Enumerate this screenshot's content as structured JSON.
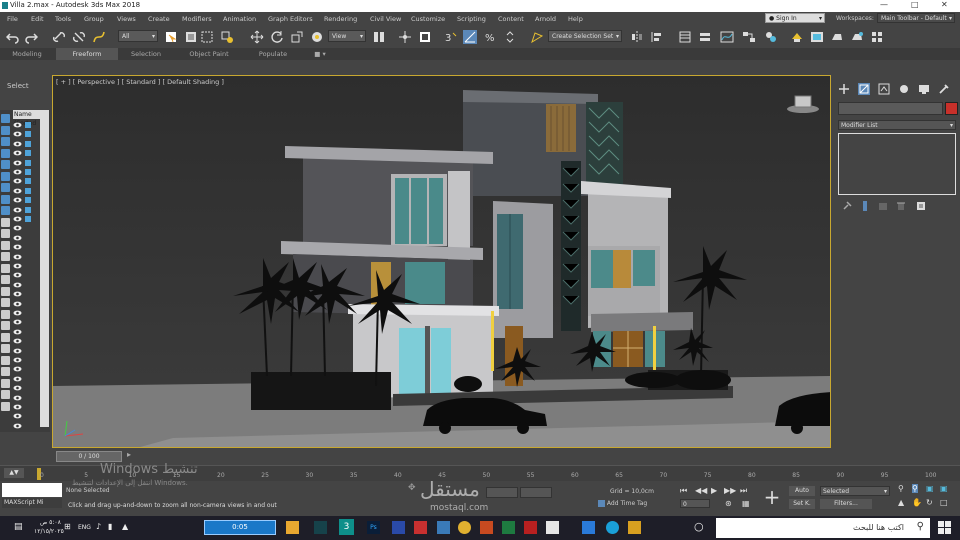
{
  "window": {
    "title": "Villa 2.max - Autodesk 3ds Max 2018"
  },
  "menu": [
    "File",
    "Edit",
    "Tools",
    "Group",
    "Views",
    "Create",
    "Modifiers",
    "Animation",
    "Graph Editors",
    "Rendering",
    "Civil View",
    "Customize",
    "Scripting",
    "Content",
    "Arnold",
    "Help"
  ],
  "account": {
    "sign_in": "Sign In",
    "workspaces_label": "Workspaces:",
    "workspace_value": "Main Toolbar - Default"
  },
  "toolbar": {
    "filter_value": "All",
    "refcoord_value": "View",
    "selection_set": "Create Selection Set"
  },
  "ribbon_tabs": [
    "Modeling",
    "Freeform",
    "Selection",
    "Object Paint",
    "Populate"
  ],
  "ribbon_active": 1,
  "left": {
    "select_label": "Select",
    "column_header": "Name (Sorted"
  },
  "viewport": {
    "label": "[ + ] [ Perspective ] [ Standard ] [ Default Shading ]"
  },
  "command_panel": {
    "modifier_list": "Modifier List",
    "color_swatch": "#c8302a"
  },
  "timeline": {
    "frame_counter": "0 / 100",
    "ticks": [
      "0",
      "5",
      "10",
      "15",
      "20",
      "25",
      "30",
      "35",
      "40",
      "45",
      "50",
      "55",
      "60",
      "65",
      "70",
      "75",
      "80",
      "85",
      "90",
      "95",
      "100"
    ]
  },
  "watermark": {
    "line1": "Windows تنشيط",
    "line2": "انتقل إلى الإعدادات لتنشيط Windows."
  },
  "status": {
    "maxscript": "MAXScript Mi",
    "selection": "None Selected",
    "prompt": "Click and drag up-and-down to zoom all non-camera views in and out",
    "grid": "Grid = 10,0cm",
    "time_tag": "Add Time Tag",
    "auto_key": "Auto",
    "set_key": "Set K.",
    "key_filter_value": "Selected",
    "filters": "Filters...",
    "spinner_value": "0"
  },
  "brand": {
    "main": "مستقل",
    "sub": "mostaql.com"
  },
  "taskbar": {
    "search_placeholder": "اكتب هنا للبحث",
    "video_time": "0:05",
    "lang": "ENG",
    "time": "٥:٠٨ ص",
    "date": "١٢/١٥/٢٠٢٥"
  }
}
